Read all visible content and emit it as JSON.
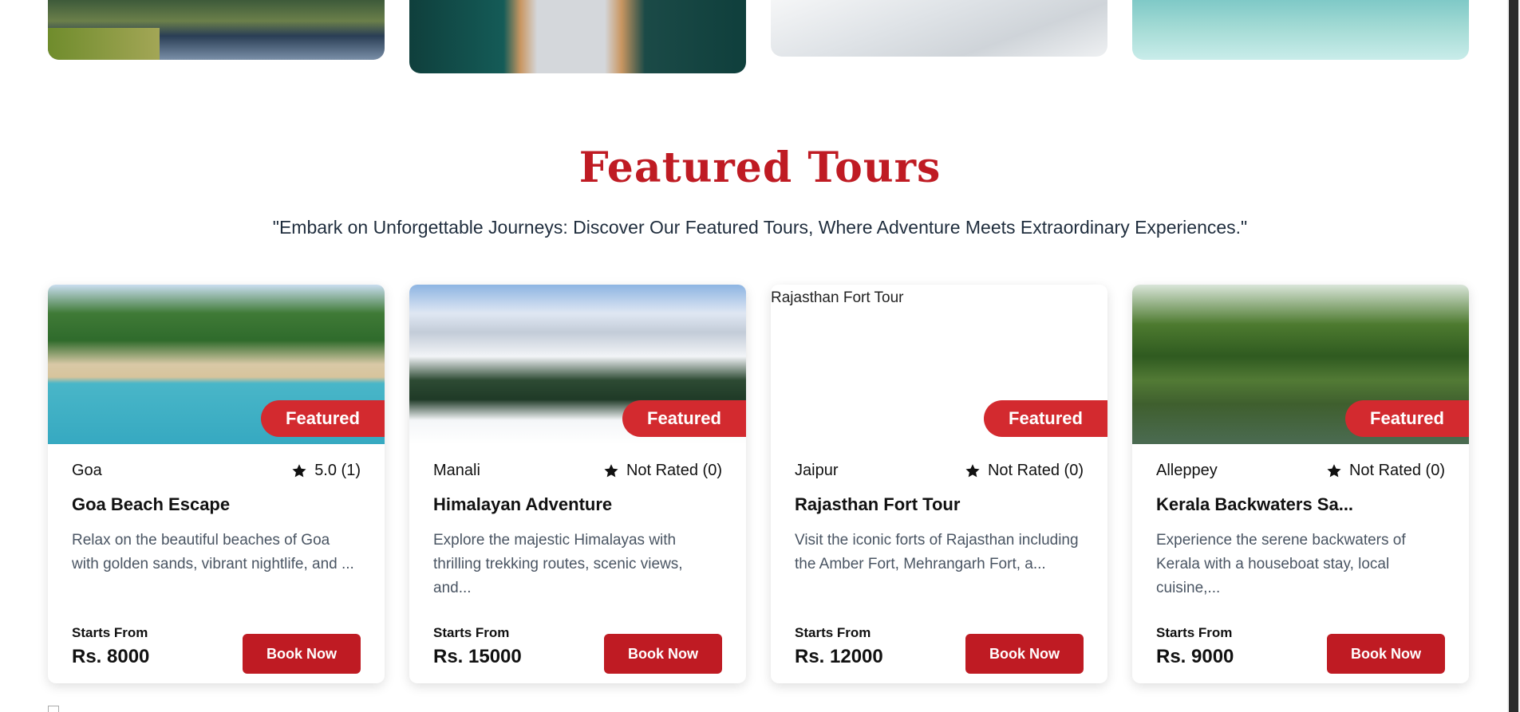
{
  "section": {
    "title": "Featured Tours",
    "subtitle": "\"Embark on Unforgettable Journeys: Discover Our Featured Tours, Where Adventure Meets Extraordinary Experiences.\""
  },
  "tours": [
    {
      "image_alt": "Goa Beach Escape",
      "badge": "Featured",
      "location": "Goa",
      "rating": "5.0 (1)",
      "title": "Goa Beach Escape",
      "description": "Relax on the beautiful beaches of Goa with golden sands, vibrant nightlife, and ...",
      "starts_label": "Starts From",
      "price": "Rs. 8000",
      "button": "Book Now"
    },
    {
      "image_alt": "Himalayan Adventure",
      "badge": "Featured",
      "location": "Manali",
      "rating": "Not Rated (0)",
      "title": "Himalayan Adventure",
      "description": "Explore the majestic Himalayas with thrilling trekking routes, scenic views, and...",
      "starts_label": "Starts From",
      "price": "Rs. 15000",
      "button": "Book Now"
    },
    {
      "image_alt": "Rajasthan Fort Tour",
      "badge": "Featured",
      "location": "Jaipur",
      "rating": "Not Rated (0)",
      "title": "Rajasthan Fort Tour",
      "description": "Visit the iconic forts of Rajasthan including the Amber Fort, Mehrangarh Fort, a...",
      "starts_label": "Starts From",
      "price": "Rs. 12000",
      "button": "Book Now"
    },
    {
      "image_alt": "Kerala Backwaters Sa...",
      "badge": "Featured",
      "location": "Alleppey",
      "rating": "Not Rated (0)",
      "title": "Kerala Backwaters Sa...",
      "description": "Experience the serene backwaters of Kerala with a houseboat stay, local cuisine,...",
      "starts_label": "Starts From",
      "price": "Rs. 9000",
      "button": "Book Now"
    }
  ],
  "icons": {
    "rating": "star-icon"
  },
  "colors": {
    "accent": "#bf1b23",
    "badge": "#d32a2f"
  }
}
